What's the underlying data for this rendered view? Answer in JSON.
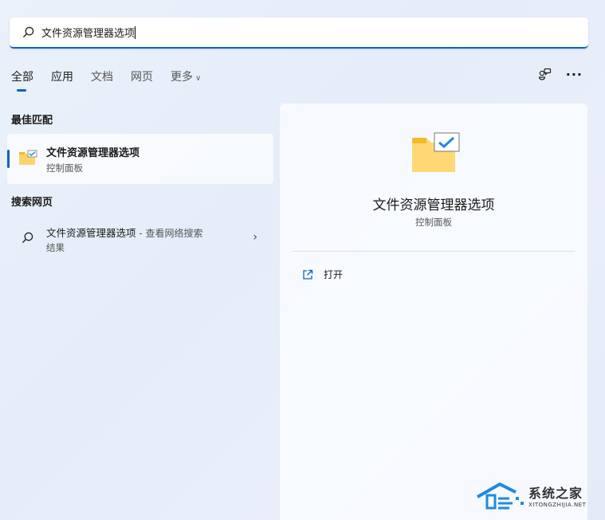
{
  "search": {
    "value": "文件资源管理器选项"
  },
  "tabs": [
    {
      "label": "全部"
    },
    {
      "label": "应用"
    },
    {
      "label": "文档"
    },
    {
      "label": "网页"
    },
    {
      "label": "更多"
    }
  ],
  "sections": {
    "best_match": "最佳匹配",
    "search_web": "搜索网页"
  },
  "best_match": {
    "title": "文件资源管理器选项",
    "subtitle": "控制面板"
  },
  "web_result": {
    "title": "文件资源管理器选项",
    "suffix": " - 查看网络搜索",
    "line2": "结果"
  },
  "detail": {
    "title": "文件资源管理器选项",
    "subtitle": "控制面板",
    "actions": [
      {
        "label": "打开"
      }
    ]
  },
  "watermark": {
    "text": "系统之家",
    "sub": "XITONGZHIJIA.NET"
  },
  "colors": {
    "accent": "#0a64c2"
  }
}
